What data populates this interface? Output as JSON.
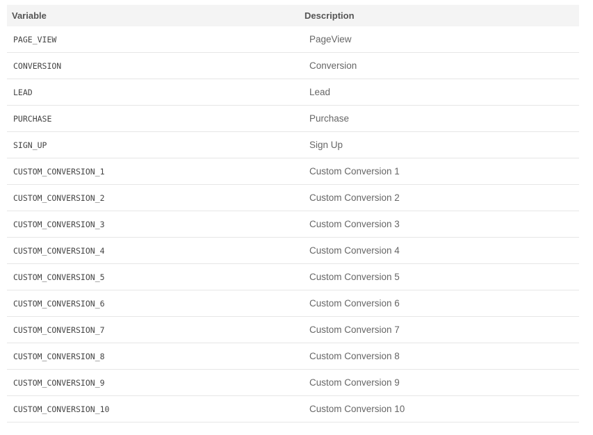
{
  "header": {
    "variable": "Variable",
    "description": "Description"
  },
  "rows": [
    {
      "variable": "PAGE_VIEW",
      "description": "PageView"
    },
    {
      "variable": "CONVERSION",
      "description": "Conversion"
    },
    {
      "variable": "LEAD",
      "description": "Lead"
    },
    {
      "variable": "PURCHASE",
      "description": "Purchase"
    },
    {
      "variable": "SIGN_UP",
      "description": "Sign Up"
    },
    {
      "variable": "CUSTOM_CONVERSION_1",
      "description": "Custom Conversion 1"
    },
    {
      "variable": "CUSTOM_CONVERSION_2",
      "description": "Custom Conversion 2"
    },
    {
      "variable": "CUSTOM_CONVERSION_3",
      "description": "Custom Conversion 3"
    },
    {
      "variable": "CUSTOM_CONVERSION_4",
      "description": "Custom Conversion 4"
    },
    {
      "variable": "CUSTOM_CONVERSION_5",
      "description": "Custom Conversion 5"
    },
    {
      "variable": "CUSTOM_CONVERSION_6",
      "description": "Custom Conversion 6"
    },
    {
      "variable": "CUSTOM_CONVERSION_7",
      "description": "Custom Conversion 7"
    },
    {
      "variable": "CUSTOM_CONVERSION_8",
      "description": "Custom Conversion 8"
    },
    {
      "variable": "CUSTOM_CONVERSION_9",
      "description": "Custom Conversion 9"
    },
    {
      "variable": "CUSTOM_CONVERSION_10",
      "description": "Custom Conversion 10"
    }
  ]
}
